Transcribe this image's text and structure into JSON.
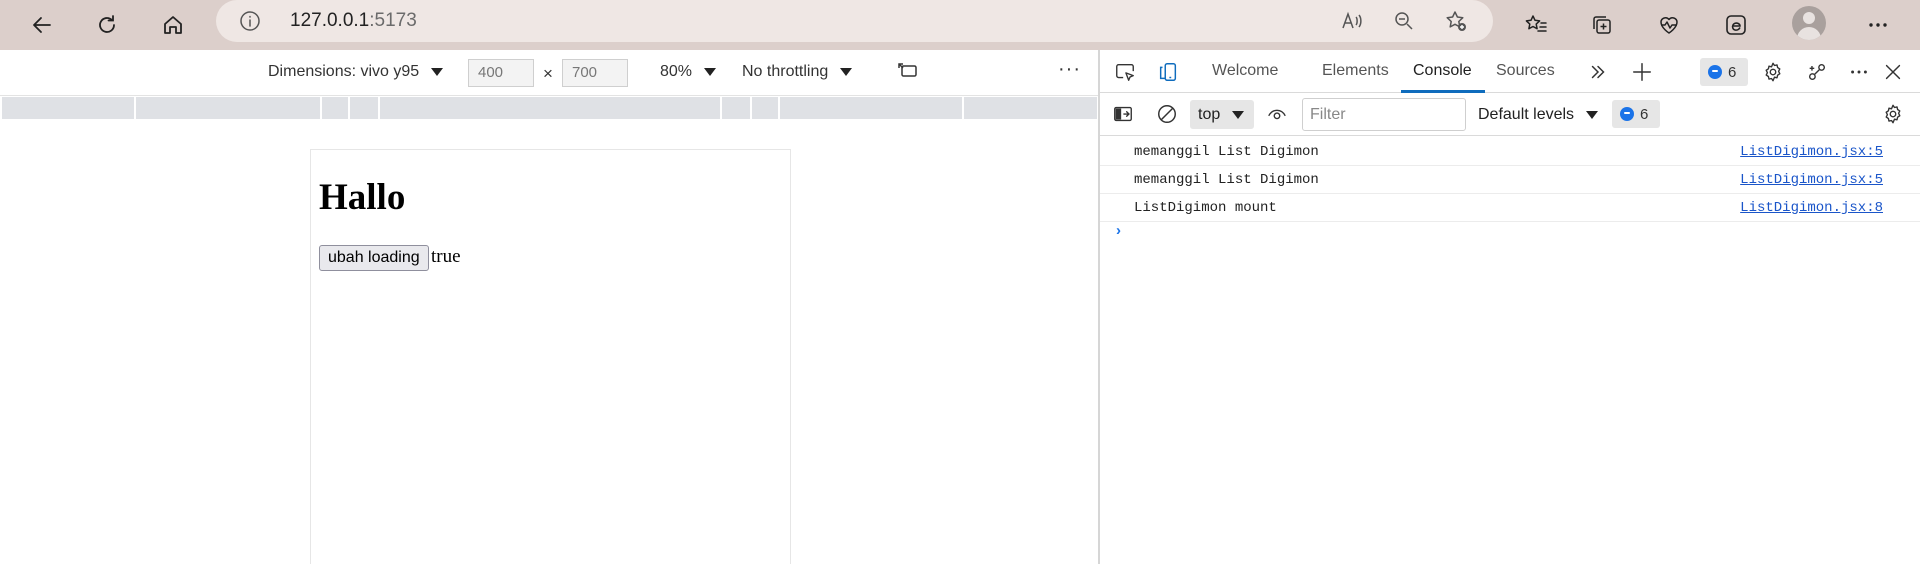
{
  "browser": {
    "url_host": "127.0.0.1",
    "url_port": ":5173"
  },
  "device_toolbar": {
    "dimensions_label": "Dimensions: vivo y95",
    "width_value": "400",
    "height_value": "700",
    "times": "×",
    "zoom": "80%",
    "throttling": "No throttling",
    "more": "···"
  },
  "page": {
    "heading": "Hallo",
    "button_label": "ubah loading",
    "value_text": "true"
  },
  "devtools": {
    "tabs": [
      "Welcome",
      "Elements",
      "Console",
      "Sources"
    ],
    "active_tab": "Console",
    "issues_count": "6",
    "context": "top",
    "filter_placeholder": "Filter",
    "levels": "Default levels",
    "messages_count": "6",
    "console_messages": [
      {
        "text": "memanggil List Digimon",
        "source": "ListDigimon.jsx:5"
      },
      {
        "text": "memanggil List Digimon",
        "source": "ListDigimon.jsx:5"
      },
      {
        "text": "ListDigimon mount",
        "source": "ListDigimon.jsx:8"
      }
    ],
    "prompt_symbol": "›"
  },
  "colors": {
    "chrome_bg": "#dccfcb",
    "accent": "#0f6cbd",
    "link": "#1a55c9"
  }
}
